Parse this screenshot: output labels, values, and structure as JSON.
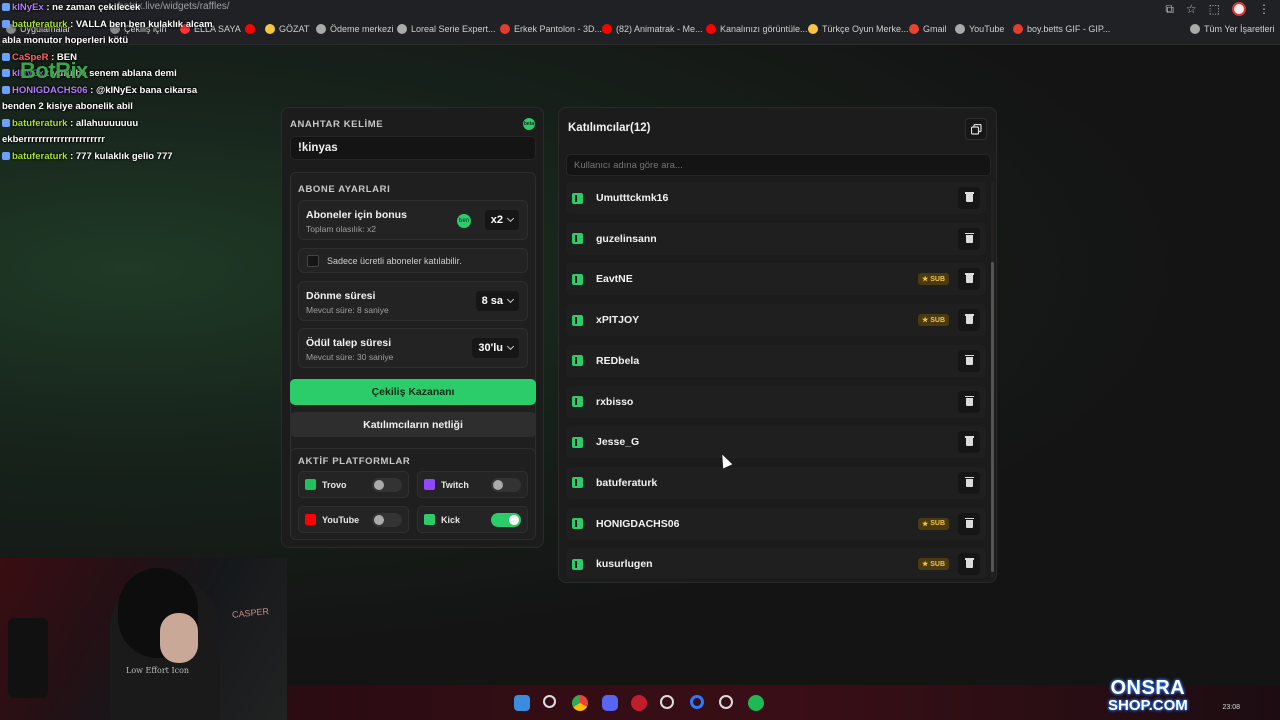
{
  "browser": {
    "url": "botrix.live/widgets/raffles/",
    "bookmarks": [
      {
        "label": "Uygulamalar",
        "color": "#888888"
      },
      {
        "label": "Çekiliş için",
        "color": "#888888"
      },
      {
        "label": "ELLA SAYA",
        "color": "#ff3333"
      },
      {
        "label": "",
        "color": "#ff0000"
      },
      {
        "label": "GÖZAT",
        "color": "#f5c542"
      },
      {
        "label": "Ödeme merkezi",
        "color": "#aaaaaa"
      },
      {
        "label": "Loreal Serie Expert...",
        "color": "#aaaaaa"
      },
      {
        "label": "Erkek Pantolon - 3D...",
        "color": "#e0402b"
      },
      {
        "label": "(82) Animatrak - Me...",
        "color": "#ff0000"
      },
      {
        "label": "Kanalınızı görüntüle...",
        "color": "#ff0000"
      },
      {
        "label": "Türkçe Oyun Merke...",
        "color": "#f5c542"
      },
      {
        "label": "Gmail",
        "color": "#ea4335"
      },
      {
        "label": "YouTube",
        "color": "#aaaaaa"
      },
      {
        "label": "boy.betts GIF - GIP...",
        "color": "#e0402b"
      },
      {
        "label": "Tüm Yer İşaretleri",
        "color": "#aaaaaa"
      }
    ]
  },
  "chat": [
    {
      "user": "kINyEx",
      "sep": " : ",
      "msg": "ne zaman çekilecek",
      "color": "u-purple"
    },
    {
      "user": "batuferaturk",
      "sep": " : ",
      "msg": "VALLA ben ben kulaklık alcam abla monutor hoperleri kötü",
      "color": "u-green"
    },
    {
      "user": "CaSpeR",
      "sep": " : ",
      "msg": "BEN",
      "color": "u-red"
    },
    {
      "user": "kINyEx",
      "sep": " : ",
      "msg": "yürü be senem ablana demi",
      "color": "u-purple"
    },
    {
      "user": "HONIGDACHS06",
      "sep": " : ",
      "msg": "@kINyEx bana cikarsa benden 2 kisiye abonelik abil",
      "color": "u-purple"
    },
    {
      "user": "batuferaturk",
      "sep": " : ",
      "msg": "allahuuuuuuu ekberrrrrrrrrrrrrrrrrrrrrr",
      "color": "u-green"
    },
    {
      "user": "batuferaturk",
      "sep": " : ",
      "msg": "777 kulaklık gelio 777",
      "color": "u-green"
    }
  ],
  "overlay": {
    "botrix": "BotRix",
    "onsra_top": "ONSRA",
    "onsra_bottom": "SHOP.COM",
    "cam_shirt": "Low Effort Icon",
    "cam_sign": "CASPER"
  },
  "left": {
    "keyword_label": "ANAHTAR KELİME",
    "keyword_badge": "beta",
    "keyword_value": "!kinyas",
    "sub_settings_label": "ABONE AYARLARI",
    "bonus_title": "Aboneler için bonus",
    "bonus_sub": "Toplam olasılık: x2",
    "bonus_badge": "ben",
    "bonus_value": "x2",
    "paid_only_label": "Sadece ücretli aboneler katılabilir.",
    "spin_title": "Dönme süresi",
    "spin_sub": "Mevcut süre: 8 saniye",
    "spin_value": "8 sa",
    "claim_title": "Ödül talep süresi",
    "claim_sub": "Mevcut süre: 30 saniye",
    "claim_value": "30'lu",
    "draw_button": "Çekiliş Kazananı",
    "clear_button": "Katılımcıların netliği",
    "platforms_label": "AKTİF PLATFORMLAR",
    "platforms": [
      {
        "name": "Trovo",
        "on": false,
        "color": "#1cc35a"
      },
      {
        "name": "Twitch",
        "on": false,
        "color": "#9146ff"
      },
      {
        "name": "YouTube",
        "on": false,
        "color": "#ff0000"
      },
      {
        "name": "Kick",
        "on": true,
        "color": "#2dcc6a"
      }
    ]
  },
  "right": {
    "title": "Katılımcılar(12)",
    "search_placeholder": "Kullanıcı adına göre ara...",
    "sub_badge": "SUB",
    "participants": [
      {
        "name": "Umutttckmk16",
        "sub": false
      },
      {
        "name": "guzelinsann",
        "sub": false
      },
      {
        "name": "EavtNE",
        "sub": true
      },
      {
        "name": "xPITJOY",
        "sub": true
      },
      {
        "name": "REDbela",
        "sub": false
      },
      {
        "name": "rxbisso",
        "sub": false
      },
      {
        "name": "Jesse_G",
        "sub": false
      },
      {
        "name": "batuferaturk",
        "sub": false
      },
      {
        "name": "HONIGDACHS06",
        "sub": true
      },
      {
        "name": "kusurlugen",
        "sub": true
      }
    ]
  },
  "taskbar": {
    "clock": "23:08"
  }
}
